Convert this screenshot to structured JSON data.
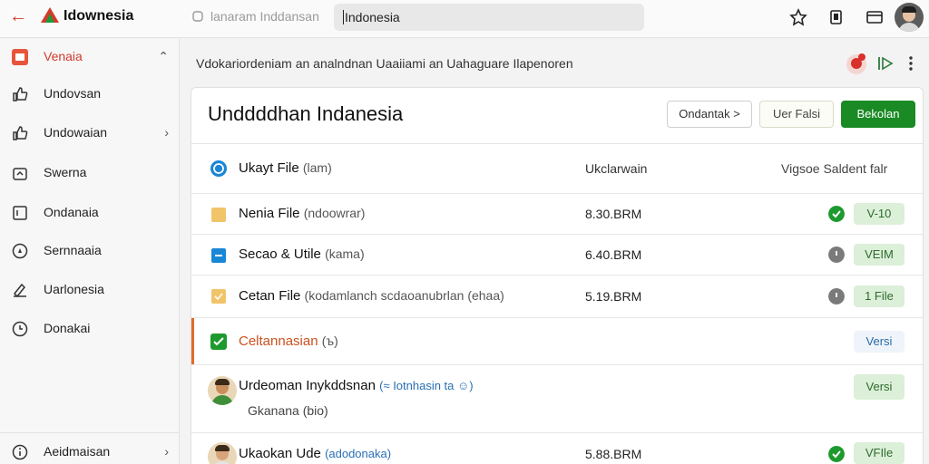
{
  "app": {
    "title": "Idownesia"
  },
  "topbar": {
    "search_ghost": "lanaram Inddansan",
    "search_value": "Indonesia"
  },
  "sidebar": {
    "items": [
      {
        "label": "Venaia",
        "icon": "home-icon",
        "active": true,
        "chevron": "⌃"
      },
      {
        "label": "Undovsan",
        "icon": "thumbs-up-icon"
      },
      {
        "label": "Undowaian",
        "icon": "thumbs-up-icon",
        "chevron": "›"
      },
      {
        "label": "Swerna",
        "icon": "share-icon"
      },
      {
        "label": "Ondanaia",
        "icon": "calendar-icon"
      },
      {
        "label": "Sernnaaia",
        "icon": "compass-icon"
      },
      {
        "label": "Uarlonesia",
        "icon": "edit-icon"
      },
      {
        "label": "Donakai",
        "icon": "clock-icon"
      },
      {
        "label": "Aeidmaisan",
        "icon": "info-icon",
        "chevron": "›"
      }
    ]
  },
  "content": {
    "header": "Vdokariordeniam an analndnan Uaaiiami an Uahaguare Ilapenoren"
  },
  "card": {
    "title": "Unddddhan Indanesia",
    "buttons": {
      "outline": "Ondantak >",
      "soft": "Uer Falsi",
      "primary": "Bekolan"
    },
    "columns": {
      "name": "Ukayt File",
      "name_sub": "(lam)",
      "size": "Ukclarwain",
      "version": "Vigsoe Saldent falr"
    },
    "rows": [
      {
        "name": "Nenia File",
        "sub": "(ndoowrar)",
        "size": "8.30.BRM",
        "status": "check",
        "tag": "V-10",
        "icon": "file-yellow-icon"
      },
      {
        "name": "Secao & Utile",
        "sub": "(kama)",
        "size": "6.40.BRM",
        "status": "gray",
        "tag": "VEIM",
        "icon": "file-blue-icon"
      },
      {
        "name": "Cetan File",
        "sub": "(kodamlanch scdaoanubrlan (ehaa)",
        "size": "5.19.BRM",
        "status": "gray",
        "tag": "1 File",
        "icon": "file-yellow-icon"
      },
      {
        "name": "Celtannasian",
        "sub": "(ъ)",
        "tag": "Versi",
        "accent": true
      },
      {
        "name": "Urdeoman Inykddsnan",
        "link": "Iotnhasin ta",
        "sub2": "Gkanana (bio)",
        "tag": "Versi"
      },
      {
        "name": "Ukaokan Ude",
        "link": "(adodonaka)",
        "size": "5.88.BRM",
        "status": "check",
        "tag": "VFIle"
      }
    ]
  },
  "colors": {
    "accent": "#d23b2b",
    "primary": "#198a24",
    "tag_bg": "#dcefd8"
  }
}
